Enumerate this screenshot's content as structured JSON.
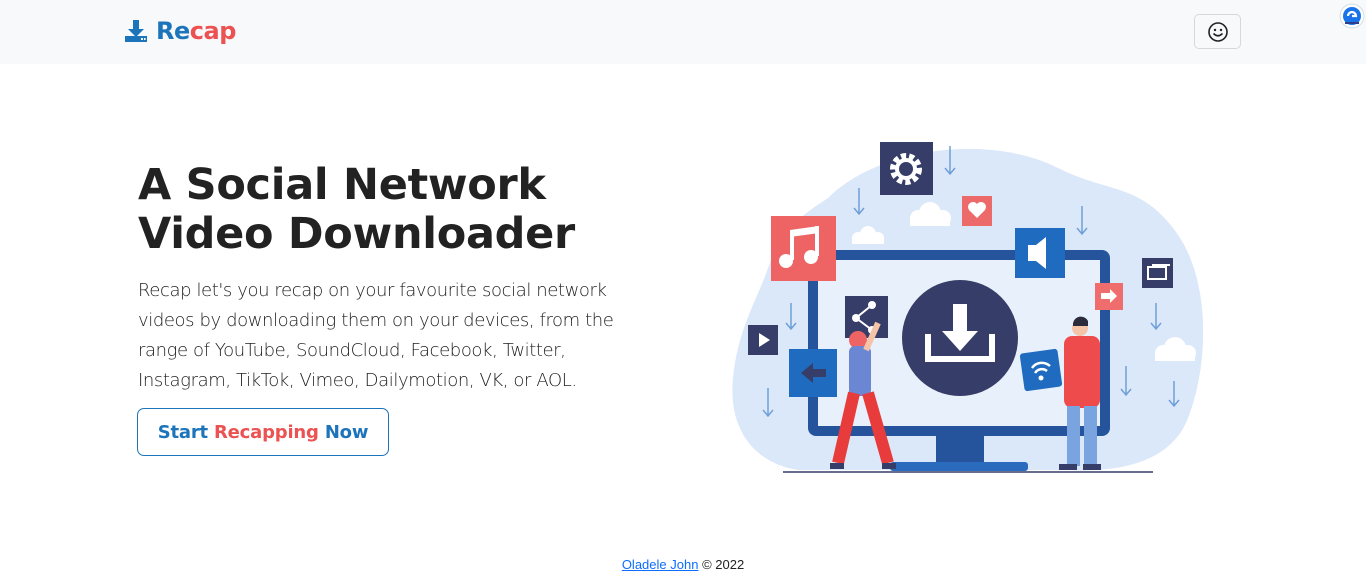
{
  "navbar": {
    "brand_re": "Re",
    "brand_cap": "cap",
    "brand_icon": "download-tray-icon",
    "theme_toggle_icon": "smiley-face-icon",
    "extension_icon": "browser-extension-icon"
  },
  "hero": {
    "title_line1": "A Social Network",
    "title_line2": "Video Downloader",
    "description": "Recap let's you recap on your favourite social network videos by downloading them on your devices, from the range of YouTube, SoundCloud, Facebook, Twitter, Instagram, TikTok, Vimeo, Dailymotion, VK, or AOL.",
    "cta_start": "Start",
    "cta_recapping": "Recapping",
    "cta_now": "Now",
    "illustration": "people-downloading-media-illustration"
  },
  "footer": {
    "author_link": "Oladele John",
    "copyright": "© 2022"
  },
  "colors": {
    "brand_blue": "#1c74bb",
    "brand_red": "#ec5252",
    "navbar_bg": "#f8f9fa",
    "navy": "#353d68"
  }
}
